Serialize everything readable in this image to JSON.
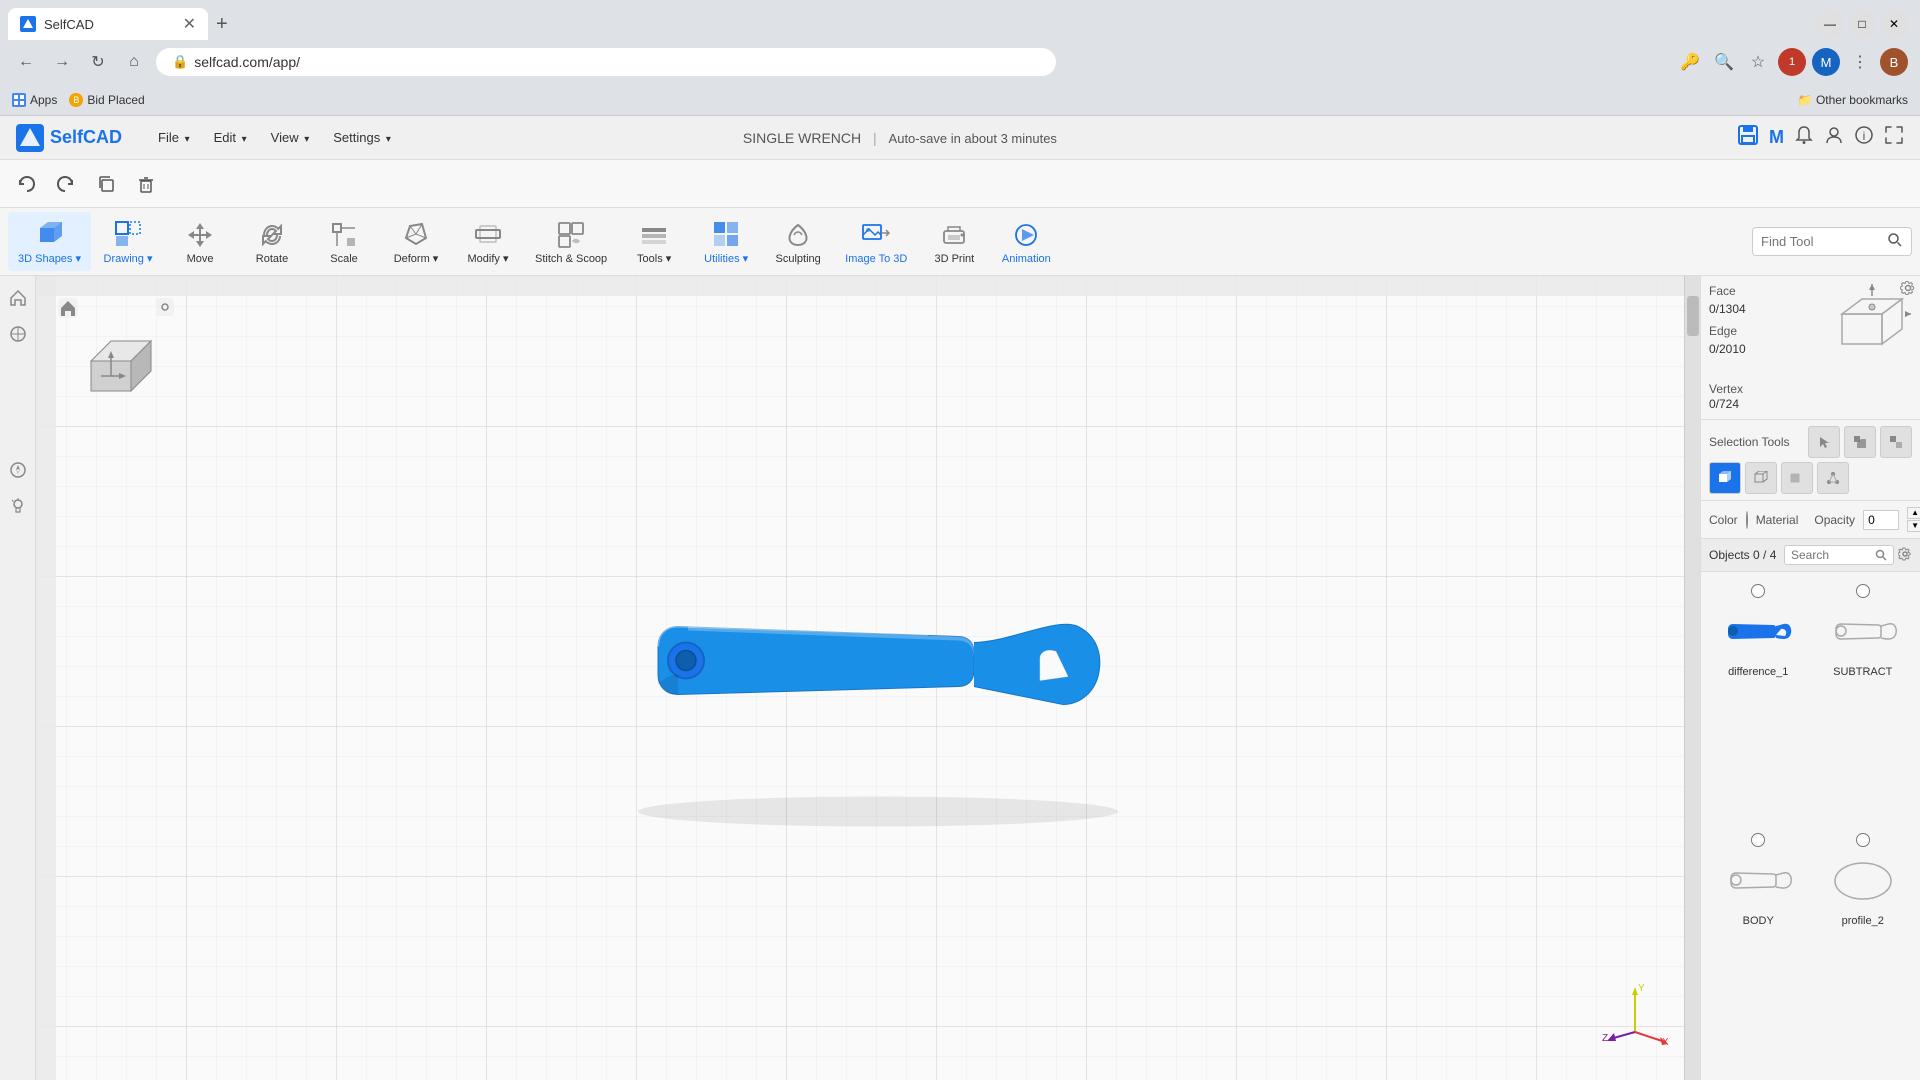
{
  "browser": {
    "tab": {
      "title": "SelfCAD",
      "favicon_color": "#1a73e8"
    },
    "address": "selfcad.com/app/",
    "bookmarks": [
      {
        "id": "apps",
        "label": "Apps",
        "icon_color": "#4285f4"
      },
      {
        "id": "bid-placed",
        "label": "Bid Placed",
        "icon_color": "#f4a300"
      }
    ],
    "other_bookmarks": "Other bookmarks"
  },
  "selfcad": {
    "logo_text": "SelfCAD",
    "menu_items": [
      "File",
      "Edit",
      "View",
      "Settings"
    ],
    "title": "SINGLE WRENCH",
    "autosave": "Auto-save in about 3 minutes",
    "toolbar": {
      "undo_label": "↩",
      "redo_label": "↪",
      "copy_label": "⧉",
      "delete_label": "🗑"
    },
    "tools": [
      {
        "id": "3d-shapes",
        "label": "3D Shapes",
        "color": "blue",
        "has_arrow": true
      },
      {
        "id": "drawing",
        "label": "Drawing",
        "color": "blue",
        "has_arrow": true
      },
      {
        "id": "move",
        "label": "Move",
        "color": "default",
        "has_arrow": false
      },
      {
        "id": "rotate",
        "label": "Rotate",
        "color": "default",
        "has_arrow": false
      },
      {
        "id": "scale",
        "label": "Scale",
        "color": "default",
        "has_arrow": false
      },
      {
        "id": "deform",
        "label": "Deform",
        "color": "default",
        "has_arrow": true
      },
      {
        "id": "modify",
        "label": "Modify",
        "color": "default",
        "has_arrow": true
      },
      {
        "id": "stitch-scoop",
        "label": "Stitch & Scoop",
        "color": "default",
        "has_arrow": false
      },
      {
        "id": "tools",
        "label": "Tools",
        "color": "default",
        "has_arrow": true
      },
      {
        "id": "utilities",
        "label": "Utilities",
        "color": "blue",
        "has_arrow": true
      },
      {
        "id": "sculpting",
        "label": "Sculpting",
        "color": "default",
        "has_arrow": false
      },
      {
        "id": "image-to-3d",
        "label": "Image To 3D",
        "color": "blue",
        "has_arrow": false
      },
      {
        "id": "3d-print",
        "label": "3D Print",
        "color": "default",
        "has_arrow": false
      },
      {
        "id": "animation",
        "label": "Animation",
        "color": "blue",
        "has_arrow": false
      }
    ],
    "find_tool": {
      "placeholder": "Find Tool",
      "search_icon": "🔍"
    },
    "right_panel": {
      "face_label": "Face",
      "face_value": "0/1304",
      "edge_label": "Edge",
      "edge_value": "0/2010",
      "vertex_label": "Vertex",
      "vertex_value": "0/724",
      "selection_tools_label": "Selection Tools",
      "color_label": "Color",
      "color_value": "#111111",
      "material_label": "Material",
      "opacity_label": "Opacity",
      "opacity_value": "0",
      "objects_label": "Objects 0 / 4",
      "search_placeholder": "Search",
      "objects": [
        {
          "id": "difference-1",
          "name": "difference_1",
          "color": "#1a73e8"
        },
        {
          "id": "subtract",
          "name": "SUBTRACT",
          "color": "#888"
        },
        {
          "id": "body",
          "name": "BODY",
          "color": "#888"
        },
        {
          "id": "profile-2",
          "name": "profile_2",
          "color": "#888"
        }
      ]
    }
  }
}
